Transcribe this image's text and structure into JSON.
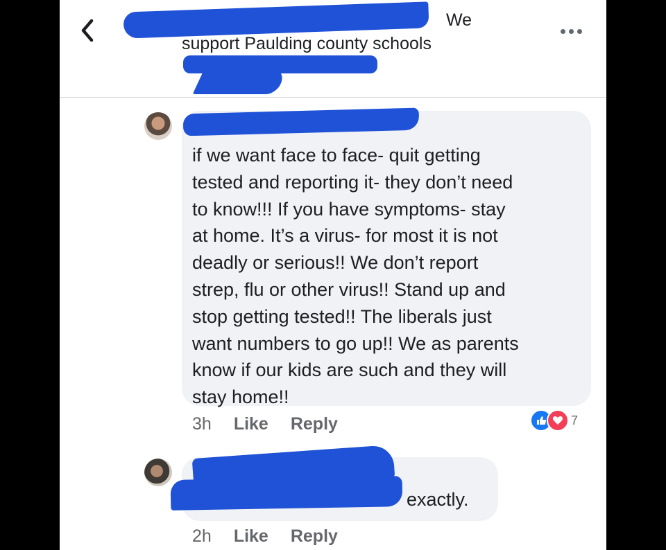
{
  "header": {
    "back_icon": "chevron-left-icon",
    "title_line1": "We",
    "title_line2": "support Paulding county schools",
    "more_icon": "more-horizontal-icon"
  },
  "comments": [
    {
      "text": "if we want face to face- quit getting\ntested and reporting it- they don’t need\nto know!!! If you have symptoms- stay\nat home. It’s a virus- for most it is not\ndeadly or serious!! We don’t report\nstrep,  flu or other virus!! Stand up and\nstop getting tested!! The liberals just\nwant numbers to go up!!  We as parents\nknow if our kids are such and they will\nstay home!!",
      "time": "3h",
      "like_label": "Like",
      "reply_label": "Reply",
      "reactions": {
        "icons": [
          "like-icon",
          "love-icon"
        ],
        "count": "7"
      }
    },
    {
      "text": "exactly.",
      "time": "2h",
      "like_label": "Like",
      "reply_label": "Reply"
    }
  ],
  "colors": {
    "redaction": "#1f52d6",
    "bubble": "#f0f2f5",
    "like": "#1877f2",
    "love": "#f33e58"
  }
}
